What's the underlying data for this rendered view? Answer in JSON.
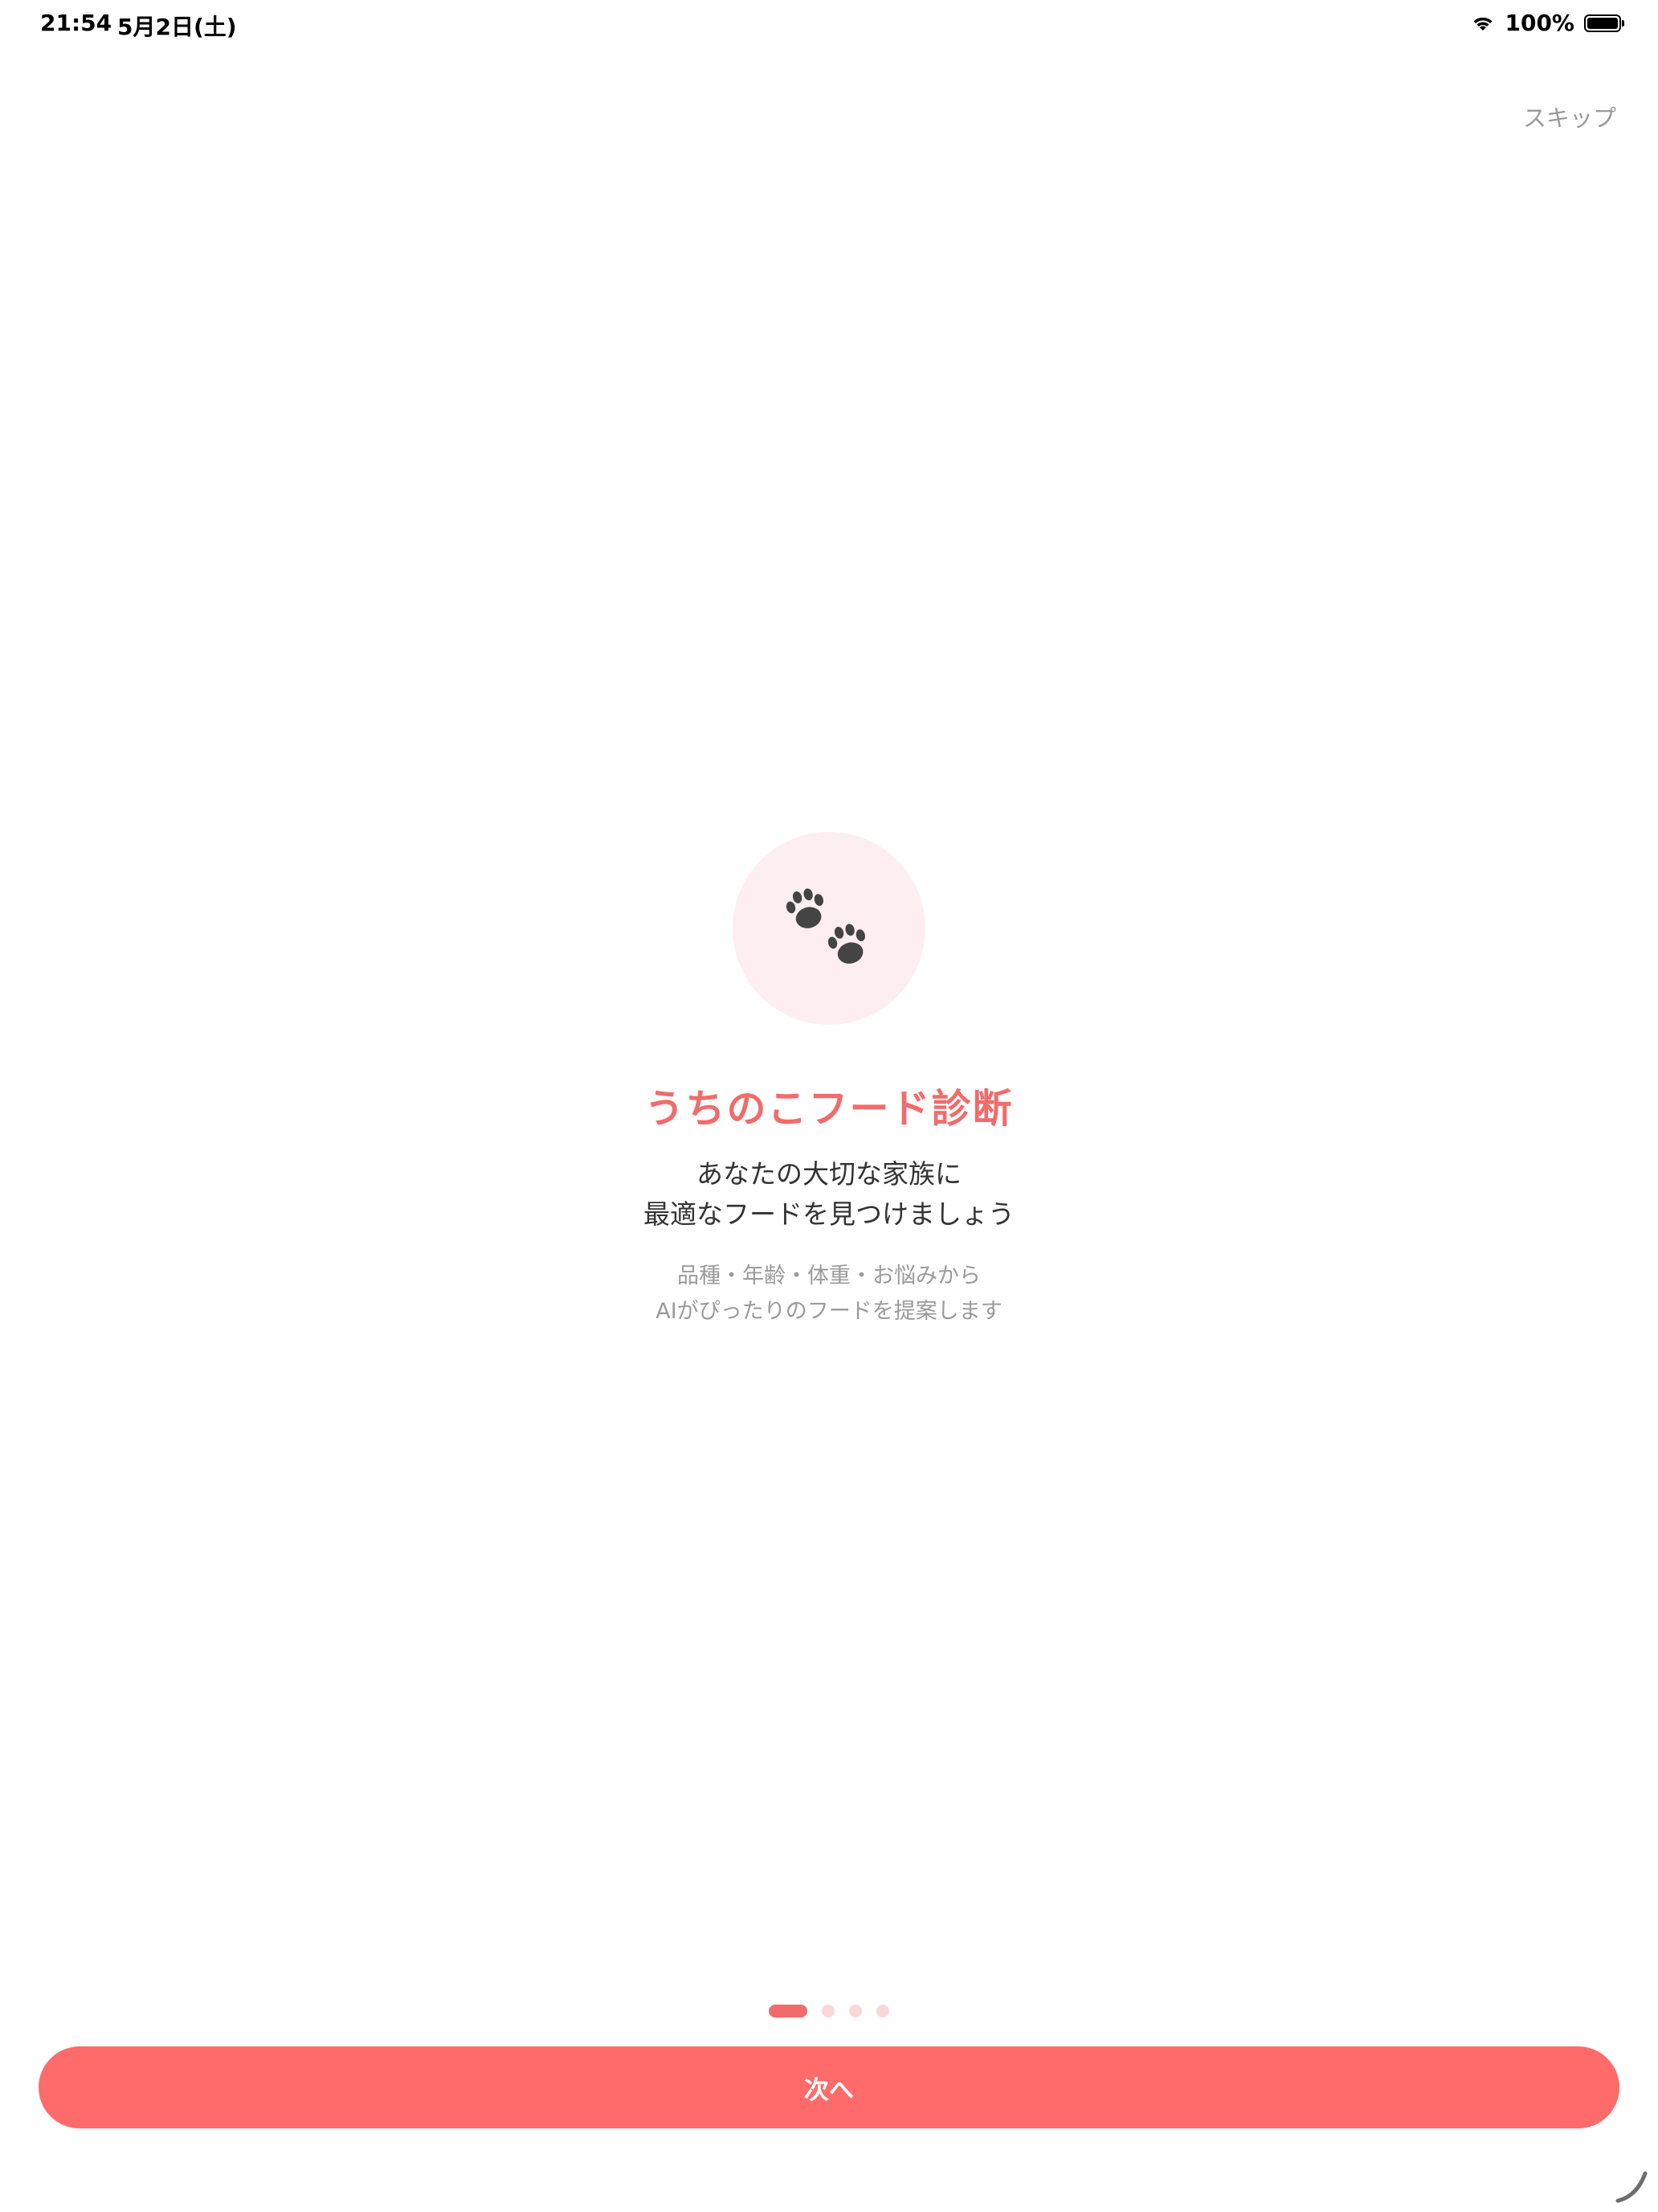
{
  "status_bar": {
    "time": "21:54",
    "date": "5月2日(土)",
    "battery": "100%",
    "wifi_icon": "wifi-icon",
    "battery_icon": "battery-icon"
  },
  "header": {
    "skip_label": "スキップ"
  },
  "hero": {
    "icon": "paw-prints-icon",
    "circle_color": "#fdeef2",
    "icon_color": "#444444"
  },
  "content": {
    "title": "うちのこフード診断",
    "subtitle_line1": "あなたの大切な家族に",
    "subtitle_line2": "最適なフードを見つけましょう",
    "description_line1": "品種・年齢・体重・お悩みから",
    "description_line2": "AIがぴったりのフードを提案します"
  },
  "pagination": {
    "total": 4,
    "current": 1
  },
  "footer": {
    "next_label": "次へ"
  },
  "colors": {
    "accent": "#ff6b6b",
    "title": "#f26b6b",
    "dot_inactive": "#fbd8d8",
    "muted_text": "#9a9a9a"
  }
}
